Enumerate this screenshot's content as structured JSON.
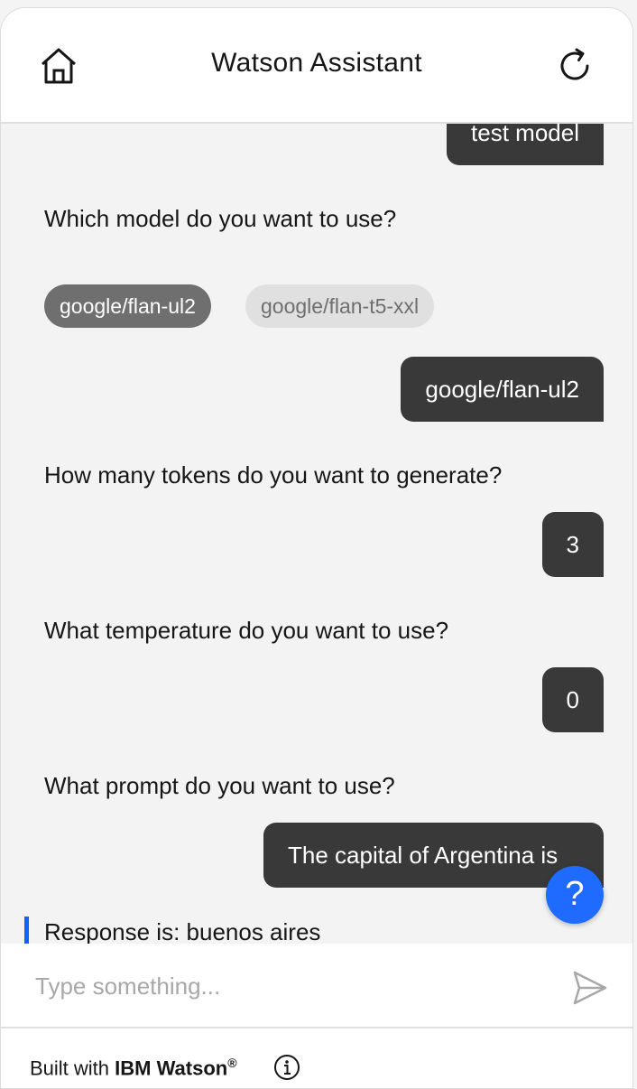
{
  "header": {
    "title": "Watson Assistant",
    "home_icon": "home-icon",
    "refresh_icon": "refresh-icon"
  },
  "messages": {
    "user_test_model": "test model",
    "bot_model_question": "Which model do you want to use?",
    "chips": [
      "google/flan-ul2",
      "google/flan-t5-xxl"
    ],
    "user_model": "google/flan-ul2",
    "bot_tokens_question": "How many tokens do you want to generate?",
    "user_tokens": "3",
    "bot_temperature_question": "What temperature do you want to use?",
    "user_temperature": "0",
    "bot_prompt_question": "What prompt do you want to use?",
    "user_prompt": "The capital of Argentina is",
    "bot_response": "Response is: buenos aires"
  },
  "help_button": {
    "label": "?"
  },
  "input": {
    "placeholder": "Type something..."
  },
  "footer": {
    "built_with": "Built with",
    "brand": "IBM Watson",
    "reg": "®"
  },
  "colors": {
    "accent": "#0f62fe",
    "user_bubble": "#393939",
    "chip_selected": "#6f6f6f",
    "chip_unselected": "#e0e0e0",
    "help_button": "#1f6bff"
  }
}
